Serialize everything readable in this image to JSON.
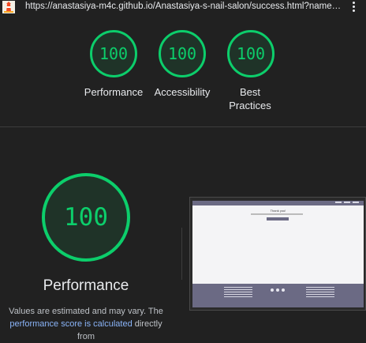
{
  "browser": {
    "url": "https://anastasiya-m4c.github.io/Anastasiya-s-nail-salon/success.html?name=A..."
  },
  "summary_scores": [
    {
      "score": "100",
      "label_line1": "Performance",
      "label_line2": ""
    },
    {
      "score": "100",
      "label_line1": "Accessibility",
      "label_line2": ""
    },
    {
      "score": "100",
      "label_line1": "Best",
      "label_line2": "Practices"
    }
  ],
  "performance": {
    "score": "100",
    "title": "Performance",
    "note_text": "Values are estimated and may vary. The",
    "note_link": "performance score is calculated",
    "note_tail": " directly from"
  },
  "thumbnail": {
    "heading": "Thank you!"
  },
  "colors": {
    "pass": "#0cce6b",
    "background": "#212121",
    "link": "#8ab4f8"
  }
}
